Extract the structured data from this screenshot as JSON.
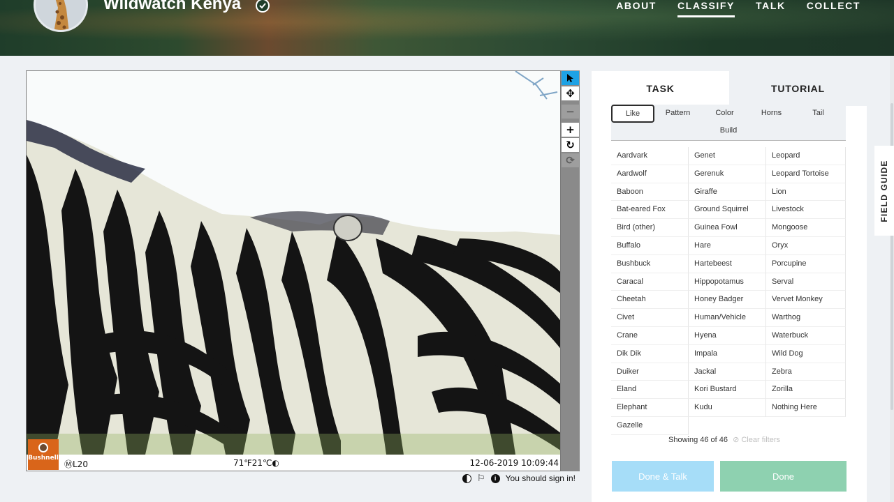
{
  "project": {
    "title": "Wildwatch Kenya"
  },
  "nav": {
    "about": "ABOUT",
    "classify": "CLASSIFY",
    "talk": "TALK",
    "collect": "COLLECT"
  },
  "camera": {
    "brand": "Bushnell",
    "id": "ⓂL20",
    "temperature": "71℉21℃◐",
    "timestamp": "12-06-2019 10:09:44"
  },
  "meta": {
    "sign_in": "You should sign in!"
  },
  "tabs": {
    "task": "TASK",
    "tutorial": "TUTORIAL"
  },
  "filters": [
    "Like",
    "Pattern",
    "Color",
    "Horns",
    "Tail",
    "Build"
  ],
  "species": [
    "Aardvark",
    "Genet",
    "Leopard",
    "Aardwolf",
    "Gerenuk",
    "Leopard Tortoise",
    "Baboon",
    "Giraffe",
    "Lion",
    "Bat-eared Fox",
    "Ground Squirrel",
    "Livestock",
    "Bird (other)",
    "Guinea Fowl",
    "Mongoose",
    "Buffalo",
    "Hare",
    "Oryx",
    "Bushbuck",
    "Hartebeest",
    "Porcupine",
    "Caracal",
    "Hippopotamus",
    "Serval",
    "Cheetah",
    "Honey Badger",
    "Vervet Monkey",
    "Civet",
    "Human/Vehicle",
    "Warthog",
    "Crane",
    "Hyena",
    "Waterbuck",
    "Dik Dik",
    "Impala",
    "Wild Dog",
    "Duiker",
    "Jackal",
    "Zebra",
    "Eland",
    "Kori Bustard",
    "Zorilla",
    "Elephant",
    "Kudu",
    "Nothing Here",
    "Gazelle"
  ],
  "summary": {
    "showing": "Showing 46 of 46",
    "clear": "Clear filters"
  },
  "buttons": {
    "done_talk": "Done & Talk",
    "done": "Done"
  },
  "field_guide": "FIELD GUIDE",
  "colors": {
    "accent": "#1ea2e5",
    "done": "#8ed1b0",
    "done_talk": "#a6ddf8"
  }
}
